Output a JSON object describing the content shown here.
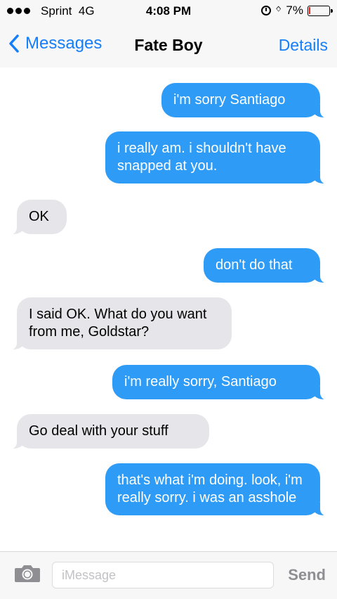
{
  "status_bar": {
    "carrier": "Sprint",
    "network": "4G",
    "time": "4:08 PM",
    "battery_percent": "7%",
    "battery_level": 0.07,
    "battery_color": "#e0241b",
    "icons": [
      "signal-dots-icon",
      "alarm-icon",
      "bluetooth-icon",
      "battery-icon"
    ]
  },
  "nav": {
    "back_label": "Messages",
    "title": "Fate Boy",
    "details_label": "Details"
  },
  "colors": {
    "accent": "#147efb",
    "outgoing_bubble": "#2e9bf6",
    "incoming_bubble": "#e6e6ea"
  },
  "messages": [
    {
      "direction": "out",
      "text": "i'm sorry Santiago"
    },
    {
      "direction": "out",
      "text": "i really am. i shouldn't have snapped at you."
    },
    {
      "direction": "in",
      "text": "OK"
    },
    {
      "direction": "out",
      "text": "don't do that"
    },
    {
      "direction": "in",
      "text": "I said OK. What do you want from me, Goldstar?"
    },
    {
      "direction": "out",
      "text": "i'm really sorry, Santiago"
    },
    {
      "direction": "in",
      "text": "Go deal with your stuff"
    },
    {
      "direction": "out",
      "text": "that's what i'm doing. look, i'm really sorry. i was an asshole"
    }
  ],
  "composer": {
    "placeholder": "iMessage",
    "value": "",
    "send_label": "Send",
    "camera_icon": "camera-icon"
  }
}
